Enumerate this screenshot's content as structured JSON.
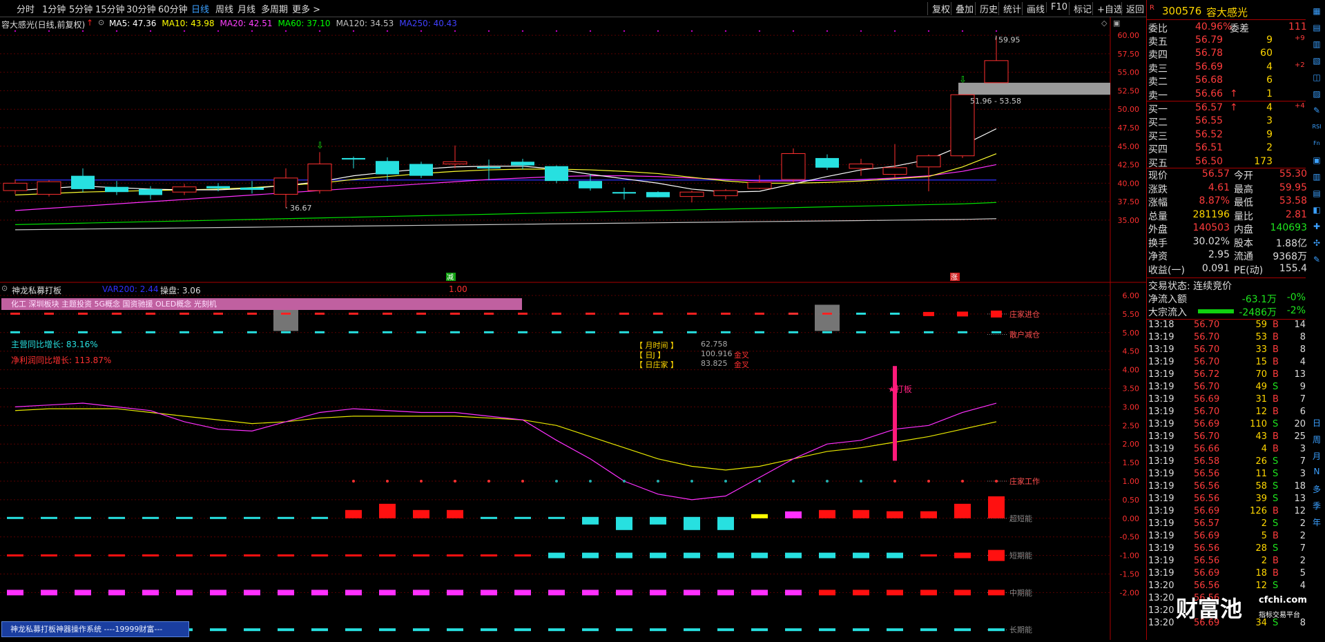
{
  "topbar": {
    "periods": [
      "分时",
      "1分钟",
      "5分钟",
      "15分钟",
      "30分钟",
      "60分钟",
      "日线",
      "周线",
      "月线",
      "多周期",
      "更多 >"
    ],
    "active": "日线",
    "right": [
      "复权",
      "叠加",
      "历史",
      "统计",
      "画线",
      "F10",
      "标记",
      "+自选",
      "返回"
    ]
  },
  "main_chart": {
    "name": "容大感光(日线,前复权)",
    "ma": [
      {
        "label": "MA5: 47.36",
        "color": "#ffffff"
      },
      {
        "label": "MA10: 43.98",
        "color": "#ffff00"
      },
      {
        "label": "MA20: 42.51",
        "color": "#ff40ff"
      },
      {
        "label": "MA60: 37.10",
        "color": "#00ff00"
      },
      {
        "label": "MA120: 34.53",
        "color": "#c0c0c0"
      },
      {
        "label": "MA250: 40.43",
        "color": "#4040ff"
      }
    ],
    "y_ticks": [
      "60.00",
      "57.50",
      "55.00",
      "52.50",
      "50.00",
      "47.50",
      "45.00",
      "42.50",
      "40.00",
      "37.50",
      "35.00"
    ],
    "hi_label": "59.95",
    "lo_label": "36.67",
    "gap_label": "51.96 - 53.58",
    "bottom_marks": [
      "减",
      "涨"
    ]
  },
  "chart_data": {
    "type": "candlestick",
    "ylim": [
      33.5,
      61.5
    ],
    "candles": [
      {
        "o": 39.0,
        "c": 40.0,
        "h": 40.5,
        "l": 38.5
      },
      {
        "o": 38.5,
        "c": 40.2,
        "h": 40.4,
        "l": 38.2
      },
      {
        "o": 41.0,
        "c": 39.2,
        "h": 42.0,
        "l": 38.8
      },
      {
        "o": 39.5,
        "c": 38.8,
        "h": 40.3,
        "l": 38.4
      },
      {
        "o": 39.2,
        "c": 38.4,
        "h": 39.6,
        "l": 37.8
      },
      {
        "o": 38.8,
        "c": 39.5,
        "h": 39.9,
        "l": 38.4
      },
      {
        "o": 39.6,
        "c": 39.3,
        "h": 40.0,
        "l": 38.9
      },
      {
        "o": 39.4,
        "c": 39.1,
        "h": 40.3,
        "l": 38.6
      },
      {
        "o": 38.5,
        "c": 40.7,
        "h": 42.0,
        "l": 36.67
      },
      {
        "o": 39.0,
        "c": 42.6,
        "h": 44.2,
        "l": 38.6
      },
      {
        "o": 43.4,
        "c": 43.2,
        "h": 43.6,
        "l": 42.0
      },
      {
        "o": 43.0,
        "c": 41.2,
        "h": 43.5,
        "l": 40.3
      },
      {
        "o": 42.6,
        "c": 41.0,
        "h": 42.9,
        "l": 40.7
      },
      {
        "o": 42.6,
        "c": 42.9,
        "h": 45.1,
        "l": 42.0
      },
      {
        "o": 42.2,
        "c": 42.0,
        "h": 43.2,
        "l": 40.4
      },
      {
        "o": 42.9,
        "c": 42.4,
        "h": 43.3,
        "l": 41.9
      },
      {
        "o": 42.3,
        "c": 40.3,
        "h": 42.4,
        "l": 40.0
      },
      {
        "o": 40.3,
        "c": 39.3,
        "h": 41.2,
        "l": 39.0
      },
      {
        "o": 38.8,
        "c": 38.6,
        "h": 39.4,
        "l": 37.8
      },
      {
        "o": 38.8,
        "c": 38.1,
        "h": 38.9,
        "l": 38.1
      },
      {
        "o": 38.2,
        "c": 38.8,
        "h": 39.0,
        "l": 37.4
      },
      {
        "o": 38.3,
        "c": 39.0,
        "h": 39.2,
        "l": 37.8
      },
      {
        "o": 39.3,
        "c": 40.1,
        "h": 41.1,
        "l": 39.2
      },
      {
        "o": 40.5,
        "c": 44.0,
        "h": 44.7,
        "l": 40.1
      },
      {
        "o": 43.4,
        "c": 42.1,
        "h": 43.9,
        "l": 41.8
      },
      {
        "o": 42.0,
        "c": 42.6,
        "h": 43.3,
        "l": 41.0
      },
      {
        "o": 41.2,
        "c": 42.1,
        "h": 45.3,
        "l": 40.7
      },
      {
        "o": 42.2,
        "c": 43.7,
        "h": 43.9,
        "l": 38.9
      },
      {
        "o": 43.7,
        "c": 51.96,
        "h": 51.96,
        "l": 43.4
      },
      {
        "o": 53.58,
        "c": 56.57,
        "h": 59.95,
        "l": 53.58
      }
    ],
    "ma5": [
      39.0,
      39.3,
      39.6,
      39.4,
      39.2,
      39.1,
      39.1,
      39.3,
      39.7,
      40.2,
      41.0,
      41.5,
      41.9,
      42.2,
      42.3,
      42.3,
      41.9,
      41.2,
      40.6,
      40.0,
      39.2,
      38.8,
      38.9,
      39.9,
      40.9,
      41.8,
      42.3,
      43.2,
      45.1,
      47.36
    ],
    "ma10": [
      38.4,
      38.6,
      38.8,
      38.9,
      39.0,
      39.1,
      39.2,
      39.4,
      39.7,
      40.0,
      40.5,
      40.9,
      41.3,
      41.6,
      41.8,
      41.9,
      41.9,
      41.8,
      41.6,
      41.3,
      40.8,
      40.3,
      40.0,
      40.0,
      40.1,
      40.3,
      40.6,
      40.9,
      42.2,
      43.98
    ],
    "ma20": [
      36.3,
      36.6,
      36.9,
      37.2,
      37.5,
      37.8,
      38.1,
      38.4,
      38.7,
      39.0,
      39.3,
      39.6,
      39.9,
      40.2,
      40.5,
      40.7,
      40.9,
      41.0,
      41.0,
      40.9,
      40.7,
      40.5,
      40.3,
      40.3,
      40.4,
      40.5,
      40.7,
      41.0,
      41.6,
      42.51
    ],
    "ma60": [
      34.4,
      34.5,
      34.6,
      34.7,
      34.8,
      34.9,
      35.0,
      35.1,
      35.2,
      35.3,
      35.4,
      35.5,
      35.6,
      35.7,
      35.8,
      35.9,
      36.0,
      36.1,
      36.2,
      36.3,
      36.4,
      36.5,
      36.6,
      36.7,
      36.8,
      36.9,
      37.0,
      37.1,
      37.2,
      37.4
    ],
    "ma120": [
      33.7,
      33.75,
      33.8,
      33.85,
      33.9,
      33.95,
      34.0,
      34.05,
      34.1,
      34.15,
      34.2,
      34.25,
      34.3,
      34.35,
      34.4,
      34.45,
      34.5,
      34.55,
      34.6,
      34.65,
      34.7,
      34.75,
      34.8,
      34.85,
      34.9,
      34.95,
      35.0,
      35.05,
      35.1,
      35.2
    ],
    "ma250": [
      40.43,
      40.43,
      40.43,
      40.43,
      40.43,
      40.43,
      40.43,
      40.43,
      40.43,
      40.43,
      40.43,
      40.43,
      40.43,
      40.43,
      40.43,
      40.43,
      40.43,
      40.43,
      40.43,
      40.43,
      40.43,
      40.43,
      40.43,
      40.43,
      40.43,
      40.43,
      40.43,
      40.43,
      40.43,
      40.43
    ]
  },
  "indicator": {
    "name": "神龙私募打板",
    "var": "VAR200: 2.44",
    "caopan": "操盘: 3.06",
    "val": "1.00",
    "banner": "化工 深圳板块 主题投资 5G概念 国资驰援 OLED概念 光刻机",
    "y_ticks": [
      "6.00",
      "5.50",
      "5.00",
      "4.50",
      "4.00",
      "3.50",
      "3.00",
      "2.50",
      "2.00",
      "1.50",
      "1.00",
      "0.50",
      "0.00",
      "-0.50",
      "-1.00",
      "-1.50",
      "-2.00"
    ],
    "right_labels": [
      "庄家进仓",
      "散户减仓",
      "庄家工作",
      "超短能",
      "短期能",
      "中期能",
      "长期能"
    ],
    "growth1": "主营同比增长: 83.16%",
    "growth2": "净利润同比增长: 113.87%",
    "box": [
      {
        "k": "【 月时间 】",
        "v": "62.758",
        "s": ""
      },
      {
        "k": "【 日J 】",
        "v": "100.916",
        "s": "金叉"
      },
      {
        "k": "【 日庄家 】",
        "v": "83.825",
        "s": "金叉"
      }
    ],
    "dabang": "★打板",
    "footer": "神龙私募打板神器操作系统 ----19999财富---",
    "j_line": [
      3.0,
      3.05,
      3.1,
      3.0,
      2.9,
      2.6,
      2.4,
      2.35,
      2.6,
      2.85,
      2.95,
      2.9,
      2.85,
      2.85,
      2.75,
      2.65,
      2.1,
      1.6,
      1.0,
      0.65,
      0.5,
      0.6,
      1.1,
      1.6,
      2.0,
      2.1,
      2.4,
      2.5,
      2.85,
      3.1
    ],
    "k_line": [
      2.9,
      2.95,
      2.95,
      2.95,
      2.85,
      2.75,
      2.65,
      2.55,
      2.6,
      2.7,
      2.75,
      2.75,
      2.75,
      2.75,
      2.7,
      2.65,
      2.5,
      2.2,
      1.9,
      1.6,
      1.4,
      1.3,
      1.4,
      1.6,
      1.8,
      1.9,
      2.05,
      2.2,
      2.4,
      2.6
    ]
  },
  "right": {
    "code": "300576",
    "name": "容大感光",
    "weibi": "40.96%",
    "weicha": "111",
    "asks": [
      {
        "l": "卖五",
        "p": "56.79",
        "v": "9",
        "d": "+9"
      },
      {
        "l": "卖四",
        "p": "56.78",
        "v": "60",
        "d": ""
      },
      {
        "l": "卖三",
        "p": "56.69",
        "v": "4",
        "d": "+2"
      },
      {
        "l": "卖二",
        "p": "56.68",
        "v": "6",
        "d": ""
      },
      {
        "l": "卖一",
        "p": "56.66",
        "v": "1",
        "d": ""
      }
    ],
    "bids": [
      {
        "l": "买一",
        "p": "56.57",
        "v": "4",
        "d": "+4"
      },
      {
        "l": "买二",
        "p": "56.55",
        "v": "3",
        "d": ""
      },
      {
        "l": "买三",
        "p": "56.52",
        "v": "9",
        "d": ""
      },
      {
        "l": "买四",
        "p": "56.51",
        "v": "2",
        "d": ""
      },
      {
        "l": "买五",
        "p": "56.50",
        "v": "173",
        "d": ""
      }
    ],
    "stats": [
      {
        "a": "现价",
        "av": "56.57",
        "b": "今开",
        "bv": "55.30"
      },
      {
        "a": "涨跌",
        "av": "4.61",
        "b": "最高",
        "bv": "59.95"
      },
      {
        "a": "涨幅",
        "av": "8.87%",
        "b": "最低",
        "bv": "53.58"
      },
      {
        "a": "总量",
        "av": "281196",
        "b": "量比",
        "bv": "2.81"
      },
      {
        "a": "外盘",
        "av": "140503",
        "b": "内盘",
        "bv": "140693"
      },
      {
        "a": "换手",
        "av": "30.02%",
        "b": "股本",
        "bv": "1.88亿"
      },
      {
        "a": "净资",
        "av": "2.95",
        "b": "流通",
        "bv": "9368万"
      },
      {
        "a": "收益(一)",
        "av": "0.091",
        "b": "PE(动)",
        "bv": "155.4"
      }
    ],
    "status": "交易状态: 连续竞价",
    "flow": [
      {
        "l": "净流入额",
        "v": "-63.1万",
        "p": "-0%"
      },
      {
        "l": "大宗流入",
        "v": "-2486万",
        "p": "-2%"
      }
    ],
    "ticks": [
      {
        "t": "13:18",
        "p": "56.70",
        "v": "59",
        "s": "B",
        "n": "14"
      },
      {
        "t": "13:19",
        "p": "56.70",
        "v": "53",
        "s": "B",
        "n": "8"
      },
      {
        "t": "13:19",
        "p": "56.70",
        "v": "33",
        "s": "B",
        "n": "8"
      },
      {
        "t": "13:19",
        "p": "56.70",
        "v": "15",
        "s": "B",
        "n": "4"
      },
      {
        "t": "13:19",
        "p": "56.72",
        "v": "70",
        "s": "B",
        "n": "13"
      },
      {
        "t": "13:19",
        "p": "56.70",
        "v": "49",
        "s": "S",
        "n": "9"
      },
      {
        "t": "13:19",
        "p": "56.69",
        "v": "31",
        "s": "B",
        "n": "7"
      },
      {
        "t": "13:19",
        "p": "56.70",
        "v": "12",
        "s": "B",
        "n": "6"
      },
      {
        "t": "13:19",
        "p": "56.69",
        "v": "110",
        "s": "S",
        "n": "20"
      },
      {
        "t": "13:19",
        "p": "56.70",
        "v": "43",
        "s": "B",
        "n": "25"
      },
      {
        "t": "13:19",
        "p": "56.66",
        "v": "4",
        "s": "B",
        "n": "3"
      },
      {
        "t": "13:19",
        "p": "56.58",
        "v": "26",
        "s": "S",
        "n": "7"
      },
      {
        "t": "13:19",
        "p": "56.56",
        "v": "11",
        "s": "S",
        "n": "3"
      },
      {
        "t": "13:19",
        "p": "56.56",
        "v": "58",
        "s": "S",
        "n": "18"
      },
      {
        "t": "13:19",
        "p": "56.56",
        "v": "39",
        "s": "S",
        "n": "13"
      },
      {
        "t": "13:19",
        "p": "56.69",
        "v": "126",
        "s": "B",
        "n": "12"
      },
      {
        "t": "13:19",
        "p": "56.57",
        "v": "2",
        "s": "S",
        "n": "2"
      },
      {
        "t": "13:19",
        "p": "56.69",
        "v": "5",
        "s": "B",
        "n": "2"
      },
      {
        "t": "13:19",
        "p": "56.56",
        "v": "28",
        "s": "S",
        "n": "7"
      },
      {
        "t": "13:19",
        "p": "56.56",
        "v": "2",
        "s": "B",
        "n": "2"
      },
      {
        "t": "13:19",
        "p": "56.69",
        "v": "18",
        "s": "B",
        "n": "5"
      },
      {
        "t": "13:20",
        "p": "56.56",
        "v": "12",
        "s": "S",
        "n": "4"
      },
      {
        "t": "13:20",
        "p": "56.56",
        "v": "",
        "s": "",
        "n": ""
      },
      {
        "t": "13:20",
        "p": "",
        "v": "",
        "s": "",
        "n": ""
      },
      {
        "t": "13:20",
        "p": "56.69",
        "v": "34",
        "s": "S",
        "n": "8"
      }
    ],
    "side_icons": [
      "日",
      "周",
      "月",
      "N",
      "多",
      "季",
      "年"
    ],
    "watermark": "财富池",
    "watermark_sub": "cfchi.com",
    "watermark_sub2": "指标交易平台"
  }
}
